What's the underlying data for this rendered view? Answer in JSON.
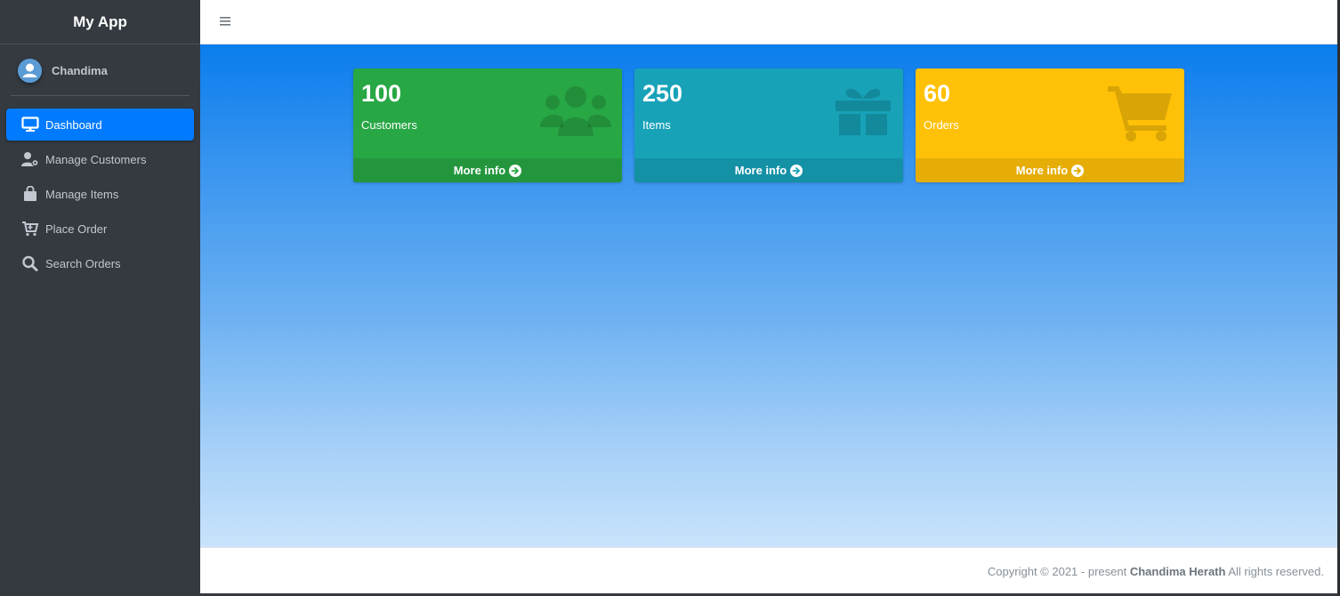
{
  "app": {
    "brand": "My App"
  },
  "user": {
    "name": "Chandima"
  },
  "sidebar": {
    "items": [
      {
        "label": "Dashboard",
        "icon": "monitor-icon",
        "active": true
      },
      {
        "label": "Manage Customers",
        "icon": "user-cog-icon",
        "active": false
      },
      {
        "label": "Manage Items",
        "icon": "shopping-bag-icon",
        "active": false
      },
      {
        "label": "Place Order",
        "icon": "cart-plus-icon",
        "active": false
      },
      {
        "label": "Search Orders",
        "icon": "search-icon",
        "active": false
      }
    ]
  },
  "header": {
    "menu_icon": "hamburger-icon"
  },
  "dashboard": {
    "boxes": [
      {
        "value": "100",
        "label": "Customers",
        "link": "More info",
        "icon": "users-icon",
        "color": "#28a745"
      },
      {
        "value": "250",
        "label": "Items",
        "link": "More info",
        "icon": "gift-icon",
        "color": "#17a2b8"
      },
      {
        "value": "60",
        "label": "Orders",
        "link": "More info",
        "icon": "shopping-cart-icon",
        "color": "#ffc107"
      }
    ]
  },
  "footer": {
    "prefix": "Copyright © 2021 - present ",
    "author": "Chandima Herath",
    "suffix": " All rights reserved."
  }
}
